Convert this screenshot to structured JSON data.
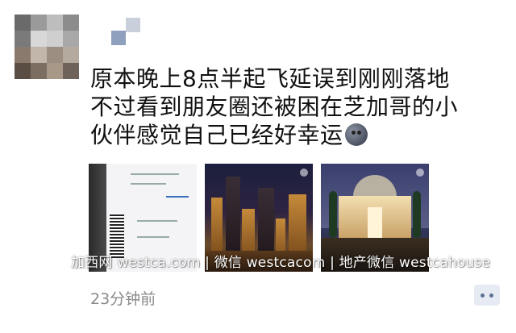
{
  "post": {
    "text_lines": [
      "原本晚上8点半起飞延误到刚刚落地",
      "不过看到朋友圈还被困在芝加哥的小",
      "伙伴感觉自己已经好幸运"
    ],
    "emoji": "sleepy-moon-face-icon",
    "timestamp": "23分钟前"
  },
  "watermark": "加西网 westca.com | 微信 westcacom | 地产微信 westcahouse",
  "colors": {
    "background": "#ffffff",
    "text": "#111111",
    "timestamp": "#8a8a8a",
    "comment_button_bg": "#e6ebf3",
    "comment_button_fg": "#5b6f95"
  },
  "icons": {
    "comment": "comment-dots-icon"
  }
}
